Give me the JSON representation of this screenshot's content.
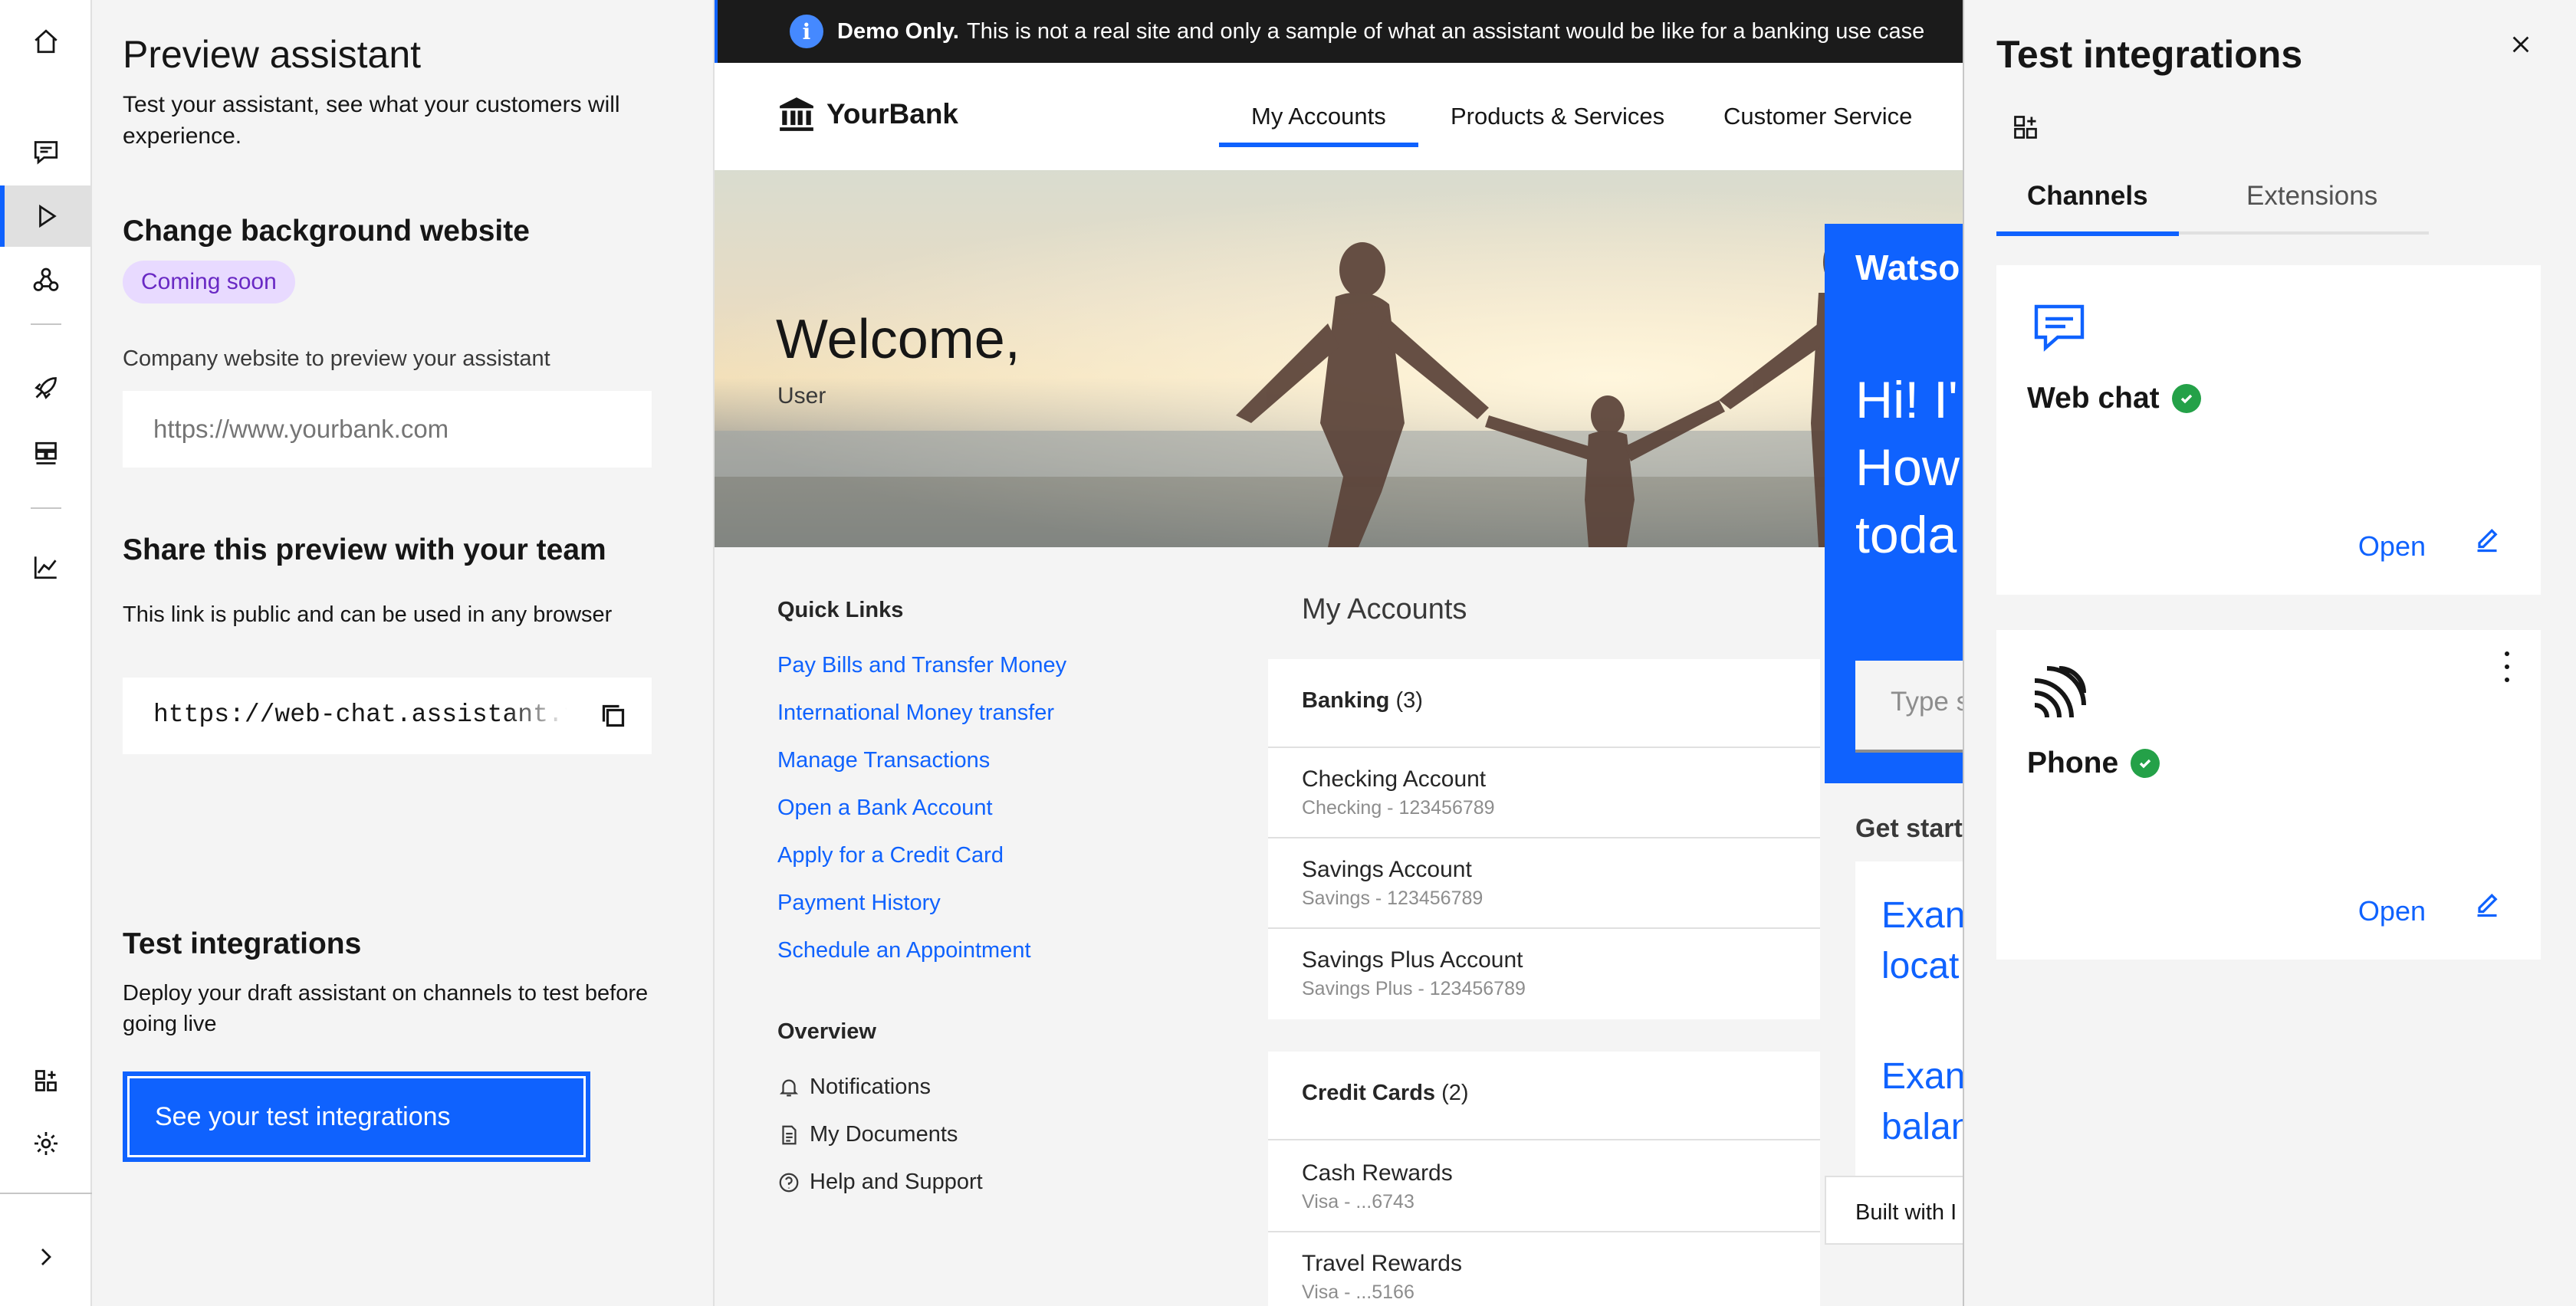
{
  "rail": {
    "items": [
      "home-icon",
      "chat-icon",
      "play-icon",
      "actions-icon",
      "rocket-icon",
      "environments-icon",
      "analytics-icon",
      "integrations-icon",
      "settings-icon",
      "chevron-right-icon"
    ],
    "active": "play-icon"
  },
  "preview": {
    "title": "Preview assistant",
    "description": "Test your assistant, see what your customers will experience.",
    "background_heading": "Change background website",
    "badge": "Coming soon",
    "website_label": "Company website to preview your assistant",
    "website_placeholder": "https://www.yourbank.com",
    "share_heading": "Share this preview with your team",
    "share_desc": "This link is public and can be used in any browser",
    "share_link": "https://web-chat.assistant.te",
    "integrations_heading": "Test integrations",
    "integrations_desc": "Deploy your draft assistant on channels to test before going live",
    "integrations_button": "See your test integrations"
  },
  "site": {
    "banner_bold": "Demo Only.",
    "banner_text": "This is not a real site and only a sample of what an assistant would be like for a banking use case",
    "logo": "YourBank",
    "nav": [
      "My Accounts",
      "Products & Services",
      "Customer Service"
    ],
    "welcome": "Welcome,",
    "user": "User",
    "quick_links_title": "Quick Links",
    "quick_links": [
      "Pay Bills and Transfer Money",
      "International Money transfer",
      "Manage Transactions",
      "Open a Bank Account",
      "Apply for a Credit Card",
      "Payment History",
      "Schedule an Appointment"
    ],
    "overview_title": "Overview",
    "overview": [
      "Notifications",
      "My Documents",
      "Help and Support"
    ],
    "accounts_title": "My Accounts",
    "banking": {
      "label": "Banking",
      "count": "(3)"
    },
    "banking_accounts": [
      {
        "name": "Checking Account",
        "sub": "Checking - 123456789"
      },
      {
        "name": "Savings Account",
        "sub": "Savings - 123456789"
      },
      {
        "name": "Savings Plus Account",
        "sub": "Savings Plus - 123456789"
      }
    ],
    "credit": {
      "label": "Credit Cards",
      "count": "(2)"
    },
    "credit_accounts": [
      {
        "name": "Cash Rewards",
        "sub": "Visa - ...6743"
      },
      {
        "name": "Travel Rewards",
        "sub": "Visa - ...5166"
      }
    ]
  },
  "chat": {
    "title": "Watso",
    "greeting_lines": [
      "Hi! I'",
      "How",
      "toda"
    ],
    "input_placeholder": "Type s",
    "get_started": "Get start",
    "example1": [
      "Exan",
      "locat"
    ],
    "example2": [
      "Exan",
      "balan"
    ],
    "built_with": "Built with I"
  },
  "test_integrations": {
    "title": "Test integrations",
    "tabs": [
      "Channels",
      "Extensions"
    ],
    "active_tab": "Channels",
    "channels": [
      {
        "name": "Web chat",
        "status": "connected",
        "open_label": "Open",
        "icon": "chat-icon"
      },
      {
        "name": "Phone",
        "status": "connected",
        "open_label": "Open",
        "icon": "phone-signal-icon"
      }
    ]
  },
  "colors": {
    "accent": "#0f62fe",
    "success": "#24a148",
    "badge_bg": "#e8daff",
    "badge_text": "#6929c4"
  }
}
